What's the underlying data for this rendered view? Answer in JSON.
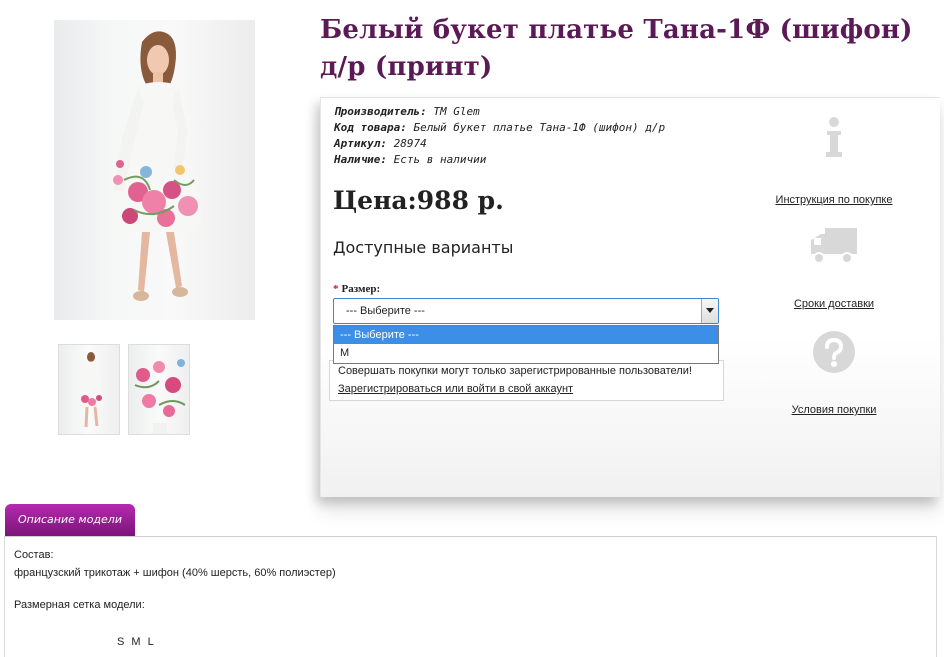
{
  "product": {
    "title": "Белый букет платье Тана-1Ф (шифон) д/р (принт)",
    "specs": [
      {
        "label": "Производитель:",
        "value": "TM Glem"
      },
      {
        "label": "Код товара:",
        "value": "Белый букет платье Тана-1Ф (шифон) д/р"
      },
      {
        "label": "Артикул:",
        "value": "28974"
      },
      {
        "label": "Наличие:",
        "value": "Есть в наличии"
      }
    ],
    "price": "Цена:988 р.",
    "variants_title": "Доступные варианты",
    "size_label": "Размер:",
    "size_required_mark": "*",
    "size_select_value": "--- Выберите ---",
    "size_options": [
      "--- Выберите ---",
      "M"
    ],
    "notice": "Совершать покупки могут только зарегистрированные пользователи!",
    "register_link": "Зарегистрироваться или войти в свой аккаунт"
  },
  "side_links": [
    {
      "label": "Инструкция по покупке",
      "icon": "info-icon"
    },
    {
      "label": "Сроки доставки",
      "icon": "truck-icon"
    },
    {
      "label": "Условия покупки",
      "icon": "question-icon"
    }
  ],
  "tabs": [
    {
      "label": "Описание модели"
    }
  ],
  "description": {
    "composition_label": "Состав:",
    "composition": "французский трикотаж + шифон (40% шерсть, 60% полиэстер)",
    "size_grid_label": "Размерная сетка модели:",
    "sizes": [
      "S",
      "M",
      "L"
    ]
  },
  "colors": {
    "title": "#5b1a55",
    "tab": "#9c1f98",
    "select_border": "#3a86d2",
    "option_highlight": "#3d8ee6",
    "required": "#e01010"
  }
}
